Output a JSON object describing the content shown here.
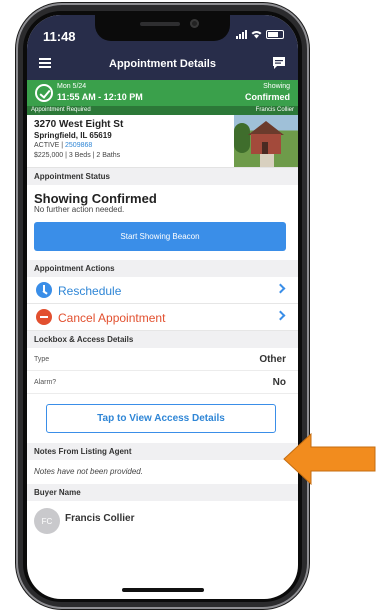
{
  "status_bar": {
    "time": "11:48"
  },
  "header": {
    "title": "Appointment Details"
  },
  "banner": {
    "date": "Mon 5/24",
    "time_range": "11:55 AM - 12:10 PM",
    "status_label": "Showing",
    "status": "Confirmed",
    "sub_left": "Appointment Required",
    "sub_right": "Francis Collier"
  },
  "listing": {
    "address": "3270 West Eight St",
    "city": "Springfield, IL 65619",
    "status": "ACTIVE",
    "mls": "2509868",
    "info": "$225,000 | 3 Beds | 2 Baths"
  },
  "appointment_status": {
    "heading": "Appointment Status",
    "title": "Showing Confirmed",
    "subtitle": "No further action needed.",
    "beacon_button": "Start Showing Beacon"
  },
  "appointment_actions": {
    "heading": "Appointment Actions",
    "reschedule": "Reschedule",
    "cancel": "Cancel Appointment"
  },
  "lockbox": {
    "heading": "Lockbox & Access Details",
    "type_label": "Type",
    "type_value": "Other",
    "alarm_label": "Alarm?",
    "alarm_value": "No",
    "access_button": "Tap to View Access Details"
  },
  "notes": {
    "heading": "Notes From Listing Agent",
    "text": "Notes have not been provided."
  },
  "buyer": {
    "heading": "Buyer Name",
    "initials": "FC",
    "name": "Francis Collier"
  },
  "colors": {
    "header_bg": "#282d4a",
    "banner_green": "#3aa04b",
    "accent_blue": "#3a8ee8",
    "cancel_red": "#e2502f",
    "arrow_orange": "#f28c1e"
  }
}
